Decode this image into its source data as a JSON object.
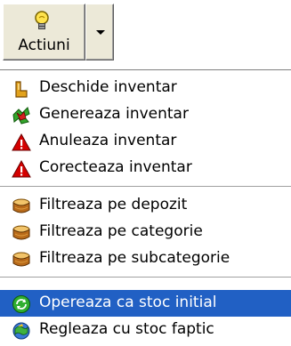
{
  "toolbar": {
    "main_button_label": "Actiuni",
    "main_icon": "lightbulb-icon",
    "dropdown_icon": "chevron-down-icon"
  },
  "menu": {
    "items": [
      {
        "label": "Deschide inventar",
        "icon": "open-lock-icon"
      },
      {
        "label": "Genereaza inventar",
        "icon": "generate-icon"
      },
      {
        "label": "Anuleaza inventar",
        "icon": "warning-icon"
      },
      {
        "label": "Corecteaza inventar",
        "icon": "warning-icon"
      },
      {
        "label": "Filtreaza pe depozit",
        "icon": "filter-box-icon"
      },
      {
        "label": "Filtreaza pe categorie",
        "icon": "filter-box-icon"
      },
      {
        "label": "Filtreaza pe subcategorie",
        "icon": "filter-box-icon"
      },
      {
        "label": "Opereaza ca stoc initial",
        "icon": "refresh-icon"
      },
      {
        "label": "Regleaza cu stoc faptic",
        "icon": "adjust-icon"
      }
    ],
    "selected_index": 7
  },
  "colors": {
    "selection": "#2160c4",
    "button_face": "#ece9d8",
    "warning": "#d40000"
  }
}
